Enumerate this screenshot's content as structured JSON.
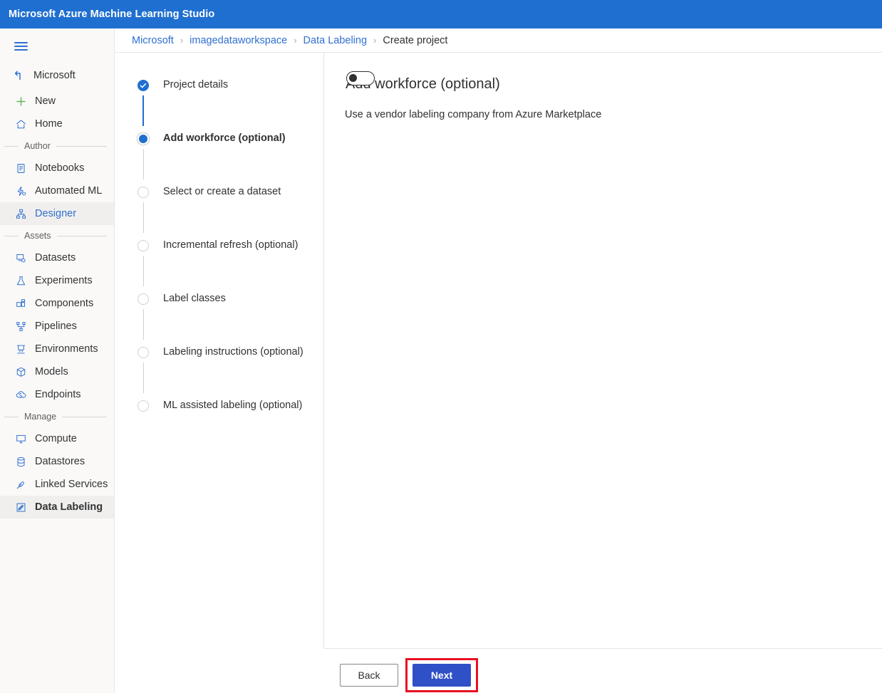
{
  "topbar": {
    "brand": "Microsoft Azure Machine Learning Studio"
  },
  "sidebar": {
    "menu_icon": "hamburger-icon",
    "back": {
      "icon": "back-arrow-icon",
      "label": "Microsoft"
    },
    "quick": [
      {
        "label": "New",
        "icon": "plus-icon",
        "color": "#5cb85c"
      },
      {
        "label": "Home",
        "icon": "home-icon",
        "color": "#2f6fd0"
      }
    ],
    "sections": [
      {
        "title": "Author",
        "items": [
          {
            "label": "Notebooks",
            "icon": "notebook-icon",
            "selected": false
          },
          {
            "label": "Automated ML",
            "icon": "automated-ml-icon",
            "selected": false
          },
          {
            "label": "Designer",
            "icon": "designer-icon",
            "selected": true
          }
        ]
      },
      {
        "title": "Assets",
        "items": [
          {
            "label": "Datasets",
            "icon": "datasets-icon",
            "selected": false
          },
          {
            "label": "Experiments",
            "icon": "experiments-flask-icon",
            "selected": false
          },
          {
            "label": "Components",
            "icon": "components-icon",
            "selected": false
          },
          {
            "label": "Pipelines",
            "icon": "pipelines-icon",
            "selected": false
          },
          {
            "label": "Environments",
            "icon": "environments-icon",
            "selected": false
          },
          {
            "label": "Models",
            "icon": "models-cube-icon",
            "selected": false
          },
          {
            "label": "Endpoints",
            "icon": "endpoints-icon",
            "selected": false
          }
        ]
      },
      {
        "title": "Manage",
        "items": [
          {
            "label": "Compute",
            "icon": "compute-monitor-icon",
            "selected": false
          },
          {
            "label": "Datastores",
            "icon": "datastores-database-icon",
            "selected": false
          },
          {
            "label": "Linked Services",
            "icon": "linked-services-icon",
            "selected": false
          },
          {
            "label": "Data Labeling",
            "icon": "data-labeling-pencil-icon",
            "selected": true
          }
        ]
      }
    ]
  },
  "breadcrumb": {
    "items": [
      {
        "label": "Microsoft",
        "is_link": true
      },
      {
        "label": "imagedataworkspace",
        "is_link": true
      },
      {
        "label": "Data Labeling",
        "is_link": true
      },
      {
        "label": "Create project",
        "is_link": false
      }
    ],
    "separator": "›"
  },
  "wizard": {
    "steps": [
      {
        "label": "Project details",
        "state": "done"
      },
      {
        "label": "Add workforce (optional)",
        "state": "current"
      },
      {
        "label": "Select or create a dataset",
        "state": "todo"
      },
      {
        "label": "Incremental refresh (optional)",
        "state": "todo"
      },
      {
        "label": "Label classes",
        "state": "todo"
      },
      {
        "label": "Labeling instructions (optional)",
        "state": "todo"
      },
      {
        "label": "ML assisted labeling (optional)",
        "state": "todo"
      }
    ]
  },
  "main": {
    "heading": "Add workforce (optional)",
    "vendor_label": "Use a vendor labeling company from Azure Marketplace",
    "vendor_toggle_state": "off"
  },
  "footer": {
    "back_label": "Back",
    "next_label": "Next",
    "highlight_color": "#e81123",
    "next_color": "#3050c8"
  }
}
